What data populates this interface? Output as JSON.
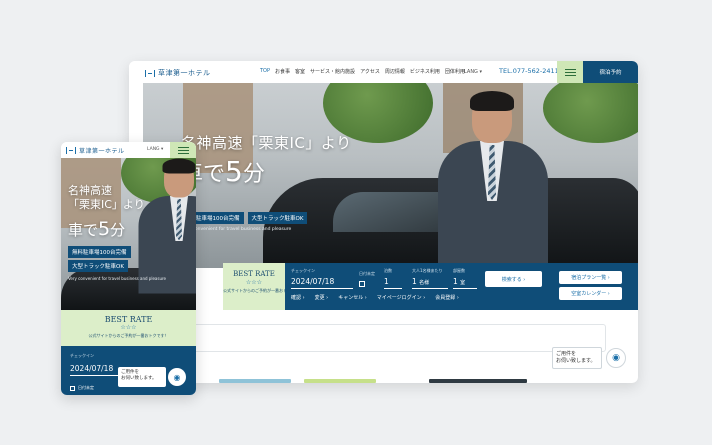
{
  "brand": {
    "name": "草津第一ホテル",
    "accent": "#0f4d78",
    "green": "#dceec9"
  },
  "desktop": {
    "nav": [
      "TOP",
      "お食事",
      "客室",
      "サービス・館内施設",
      "アクセス",
      "周辺情報",
      "ビジネス利用",
      "団体利用"
    ],
    "lang": "LANG ▾",
    "tel": "TEL.077-562-2411",
    "reserve": "宿泊予約",
    "hero": {
      "line1": "名神高速「栗東IC」より",
      "line2_prefix": "車で",
      "line2_big": "5",
      "line2_suffix": "分",
      "badge1": "無料駐車場100台完備",
      "badge2": "大型トラック駐車OK",
      "sub": "Very convenient for travel business and pleasure"
    },
    "booking": {
      "best_title": "BEST RATE",
      "stars": "☆☆☆",
      "best_sub": "公式サイトからのご予約が一番おトクです！",
      "checkin_label": "チェックイン",
      "checkin": "2024/07/18",
      "nights_label": "日付未定",
      "rooms_label": "泊数",
      "rooms": "1",
      "adults_label": "大人1名様あたり",
      "adults": "1",
      "adults_unit": "名様",
      "count_label": "部屋数",
      "count": "1",
      "count_unit": "室",
      "search": "検索する ›",
      "plans": "宿泊プラン一覧 ›",
      "calendar": "空室カレンダー ›",
      "links": [
        "確認 ›",
        "変更 ›",
        "キャンセル ›",
        "マイページログイン ›",
        "会員登録 ›"
      ]
    },
    "chat": {
      "line1": "ご用件を",
      "line2": "お伺い致します。"
    }
  },
  "mobile": {
    "lang": "LANG ▾",
    "hero": {
      "line1a": "名神高速",
      "line1b": "「栗東IC」より",
      "line2_prefix": "車で",
      "line2_big": "5",
      "line2_suffix": "分",
      "badge1": "無料駐車場100台完備",
      "badge2": "大型トラック駐車OK",
      "sub": "Very convenient for travel business and pleasure"
    },
    "booking": {
      "best_title": "BEST RATE",
      "stars": "☆☆☆",
      "best_sub": "公式サイトからのご予約が一番おトクです！",
      "checkin_label": "チェックイン",
      "checkin": "2024/07/18",
      "undecided": "日付未定"
    },
    "chat": {
      "line1": "ご用件を",
      "line2": "お伺い致します。"
    }
  }
}
